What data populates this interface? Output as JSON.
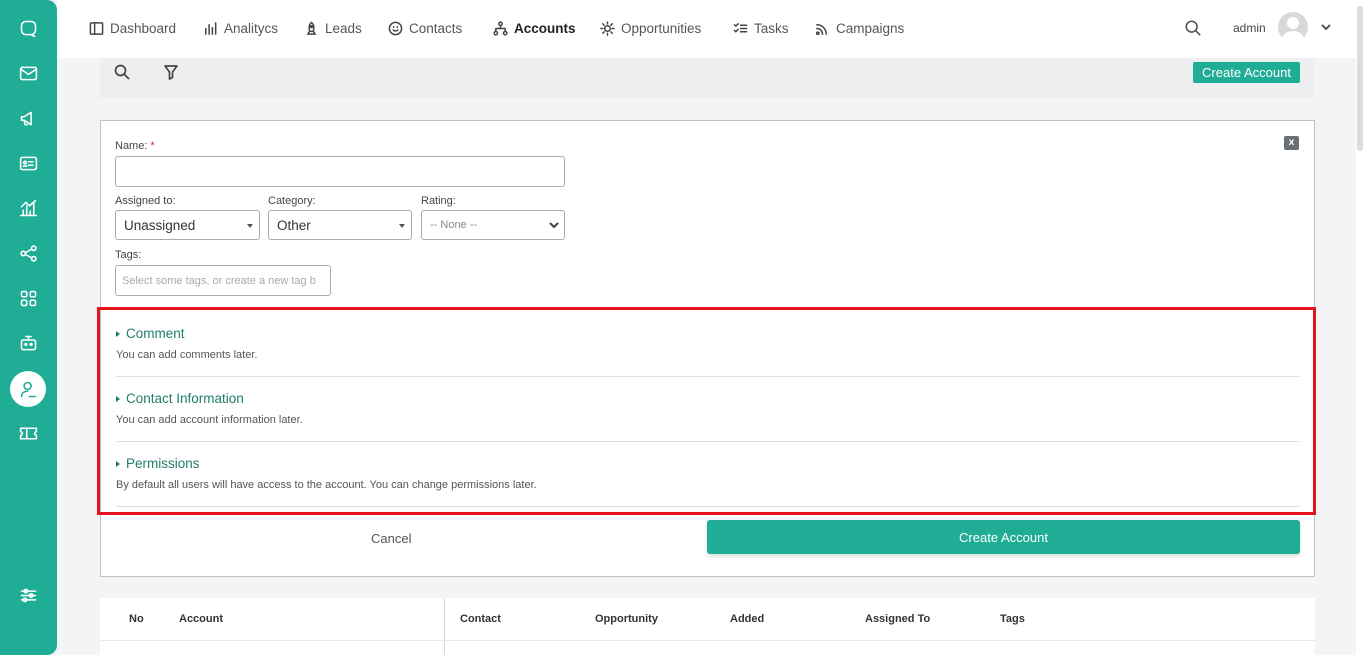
{
  "nav": {
    "items": [
      {
        "label": "Dashboard",
        "icon": "dashboard-icon",
        "active": false
      },
      {
        "label": "Analitycs",
        "icon": "analytics-icon",
        "active": false
      },
      {
        "label": "Leads",
        "icon": "rocket-icon",
        "active": false
      },
      {
        "label": "Contacts",
        "icon": "smiley-icon",
        "active": false
      },
      {
        "label": "Accounts",
        "icon": "org-chart-icon",
        "active": true
      },
      {
        "label": "Opportunities",
        "icon": "sun-icon",
        "active": false
      },
      {
        "label": "Tasks",
        "icon": "checklist-icon",
        "active": false
      },
      {
        "label": "Campaigns",
        "icon": "broadcast-icon",
        "active": false
      }
    ],
    "user": "admin"
  },
  "sidebar": {
    "items": [
      "chat-icon",
      "mail-icon",
      "megaphone-icon",
      "id-card-icon",
      "chart-icon",
      "share-icon",
      "apps-icon",
      "robot-icon",
      "user-icon",
      "ticket-icon",
      "sliders-icon"
    ],
    "active": "user-icon"
  },
  "toolbar": {
    "create_label": "Create Account"
  },
  "form": {
    "close_label": "x",
    "name_label": "Name:",
    "name_required": "*",
    "name_value": "",
    "assigned_label": "Assigned to:",
    "assigned_value": "Unassigned",
    "category_label": "Category:",
    "category_value": "Other",
    "rating_label": "Rating:",
    "rating_value": "-- None --",
    "tags_label": "Tags:",
    "tags_placeholder": "Select some tags, or create a new tag b",
    "sections": [
      {
        "title": "Comment",
        "desc": "You can add comments later."
      },
      {
        "title": "Contact Information",
        "desc": "You can add account information later."
      },
      {
        "title": "Permissions",
        "desc": "By default all users will have access to the account. You can change permissions later."
      }
    ],
    "cancel_label": "Cancel",
    "submit_label": "Create Account"
  },
  "table": {
    "columns": [
      "No",
      "Account",
      "Contact",
      "Opportunity",
      "Added",
      "Assigned To",
      "Tags"
    ]
  },
  "colors": {
    "accent": "#20ad96",
    "highlight": "#e3141c"
  }
}
